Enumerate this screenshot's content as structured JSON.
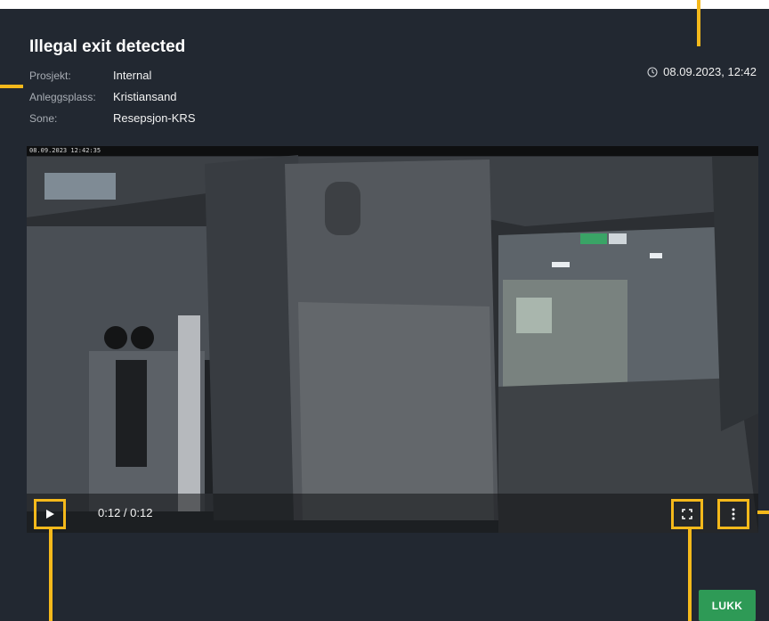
{
  "dialog": {
    "title": "Illegal exit detected",
    "meta": [
      {
        "label": "Prosjekt:",
        "value": "Internal"
      },
      {
        "label": "Anleggsplass:",
        "value": "Kristiansand"
      },
      {
        "label": "Sone:",
        "value": "Resepsjon-KRS"
      }
    ],
    "timestamp": "08.09.2023, 12:42",
    "clock_icon": "clock-icon"
  },
  "video": {
    "camera_timestamp": "08.09.2023 12:42:35",
    "time_display": "0:12 / 0:12",
    "progress": 1.0,
    "play_icon": "play-icon",
    "fullscreen_icon": "fullscreen-icon",
    "more_icon": "more-vertical-icon"
  },
  "actions": {
    "close_label": "LUKK"
  },
  "colors": {
    "panel": "#222831",
    "accent_highlight": "#f5b91b",
    "close_button": "#2e9a56"
  }
}
